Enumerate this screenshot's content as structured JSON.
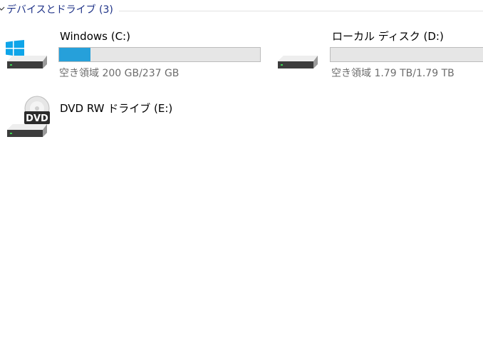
{
  "group": {
    "title": "デバイスとドライブ (3)"
  },
  "drives": [
    {
      "name": "Windows (C:)",
      "free_text": "空き領域 200 GB/237 GB",
      "used_fraction": 0.156,
      "icon": "windows-drive-icon"
    },
    {
      "name": "ローカル ディスク (D:)",
      "free_text": "空き領域 1.79 TB/1.79 TB",
      "used_fraction": 0.0,
      "icon": "hard-drive-icon"
    },
    {
      "name": "DVD RW ドライブ (E:)",
      "icon": "dvd-drive-icon",
      "badge": "DVD"
    }
  ],
  "colors": {
    "usage_fill": "#26a0da",
    "group_title": "#1e3287",
    "free_text": "#6d6d6d"
  }
}
